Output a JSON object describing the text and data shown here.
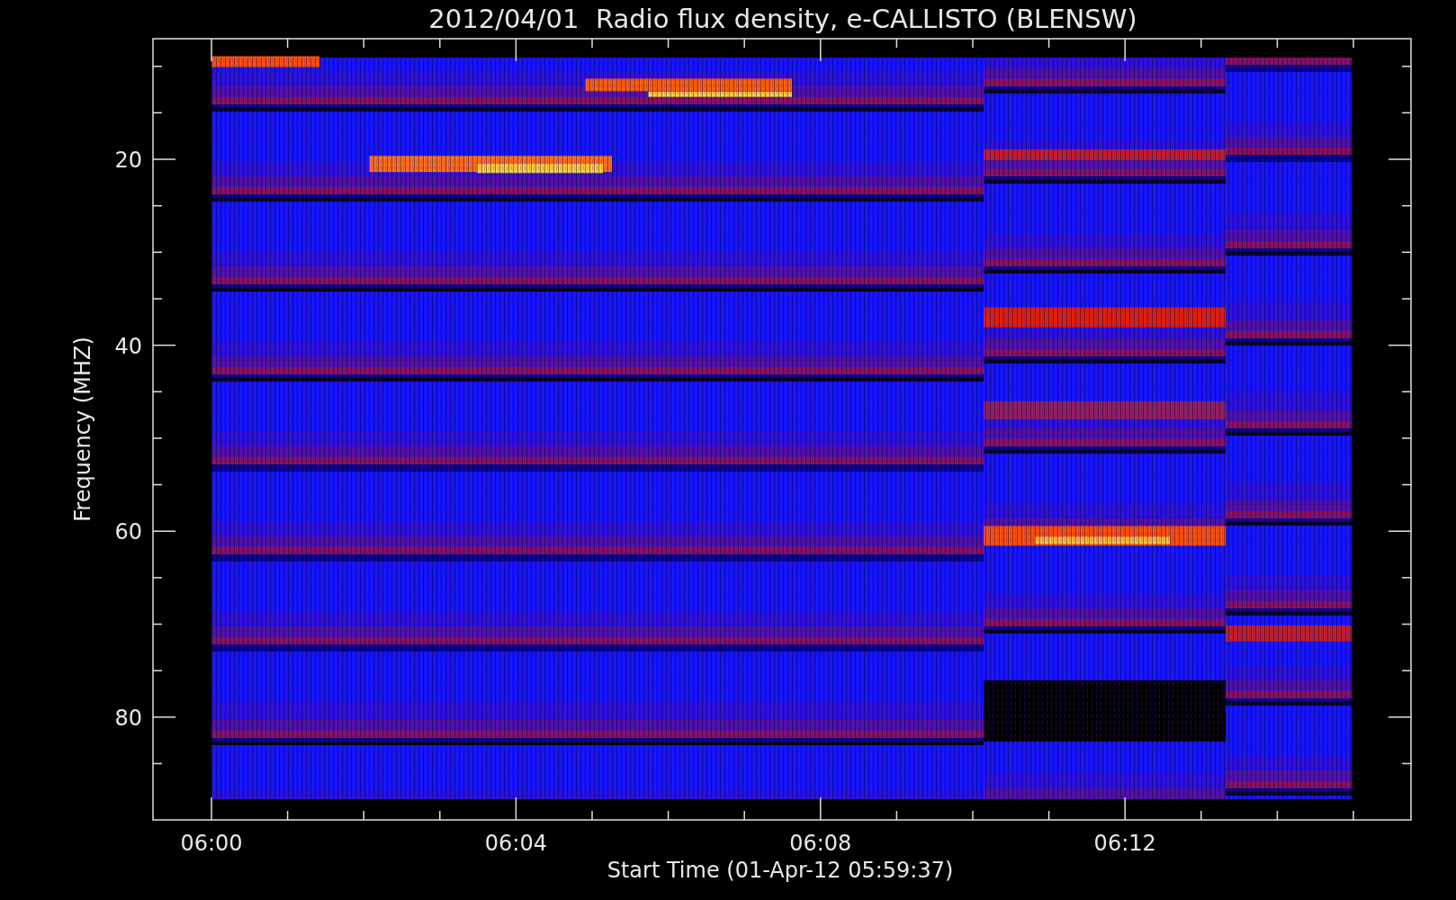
{
  "plot": {
    "title": "2012/04/01  Radio flux density, e-CALLISTO (BLENSW)",
    "x_axis_label": "Start Time (01-Apr-12 05:59:37)",
    "y_axis_label": "Frequency (MHZ)",
    "y_tick_labels": [
      "20",
      "40",
      "60",
      "80"
    ],
    "x_tick_labels": [
      "06:00",
      "06:04",
      "06:08",
      "06:12"
    ]
  }
}
